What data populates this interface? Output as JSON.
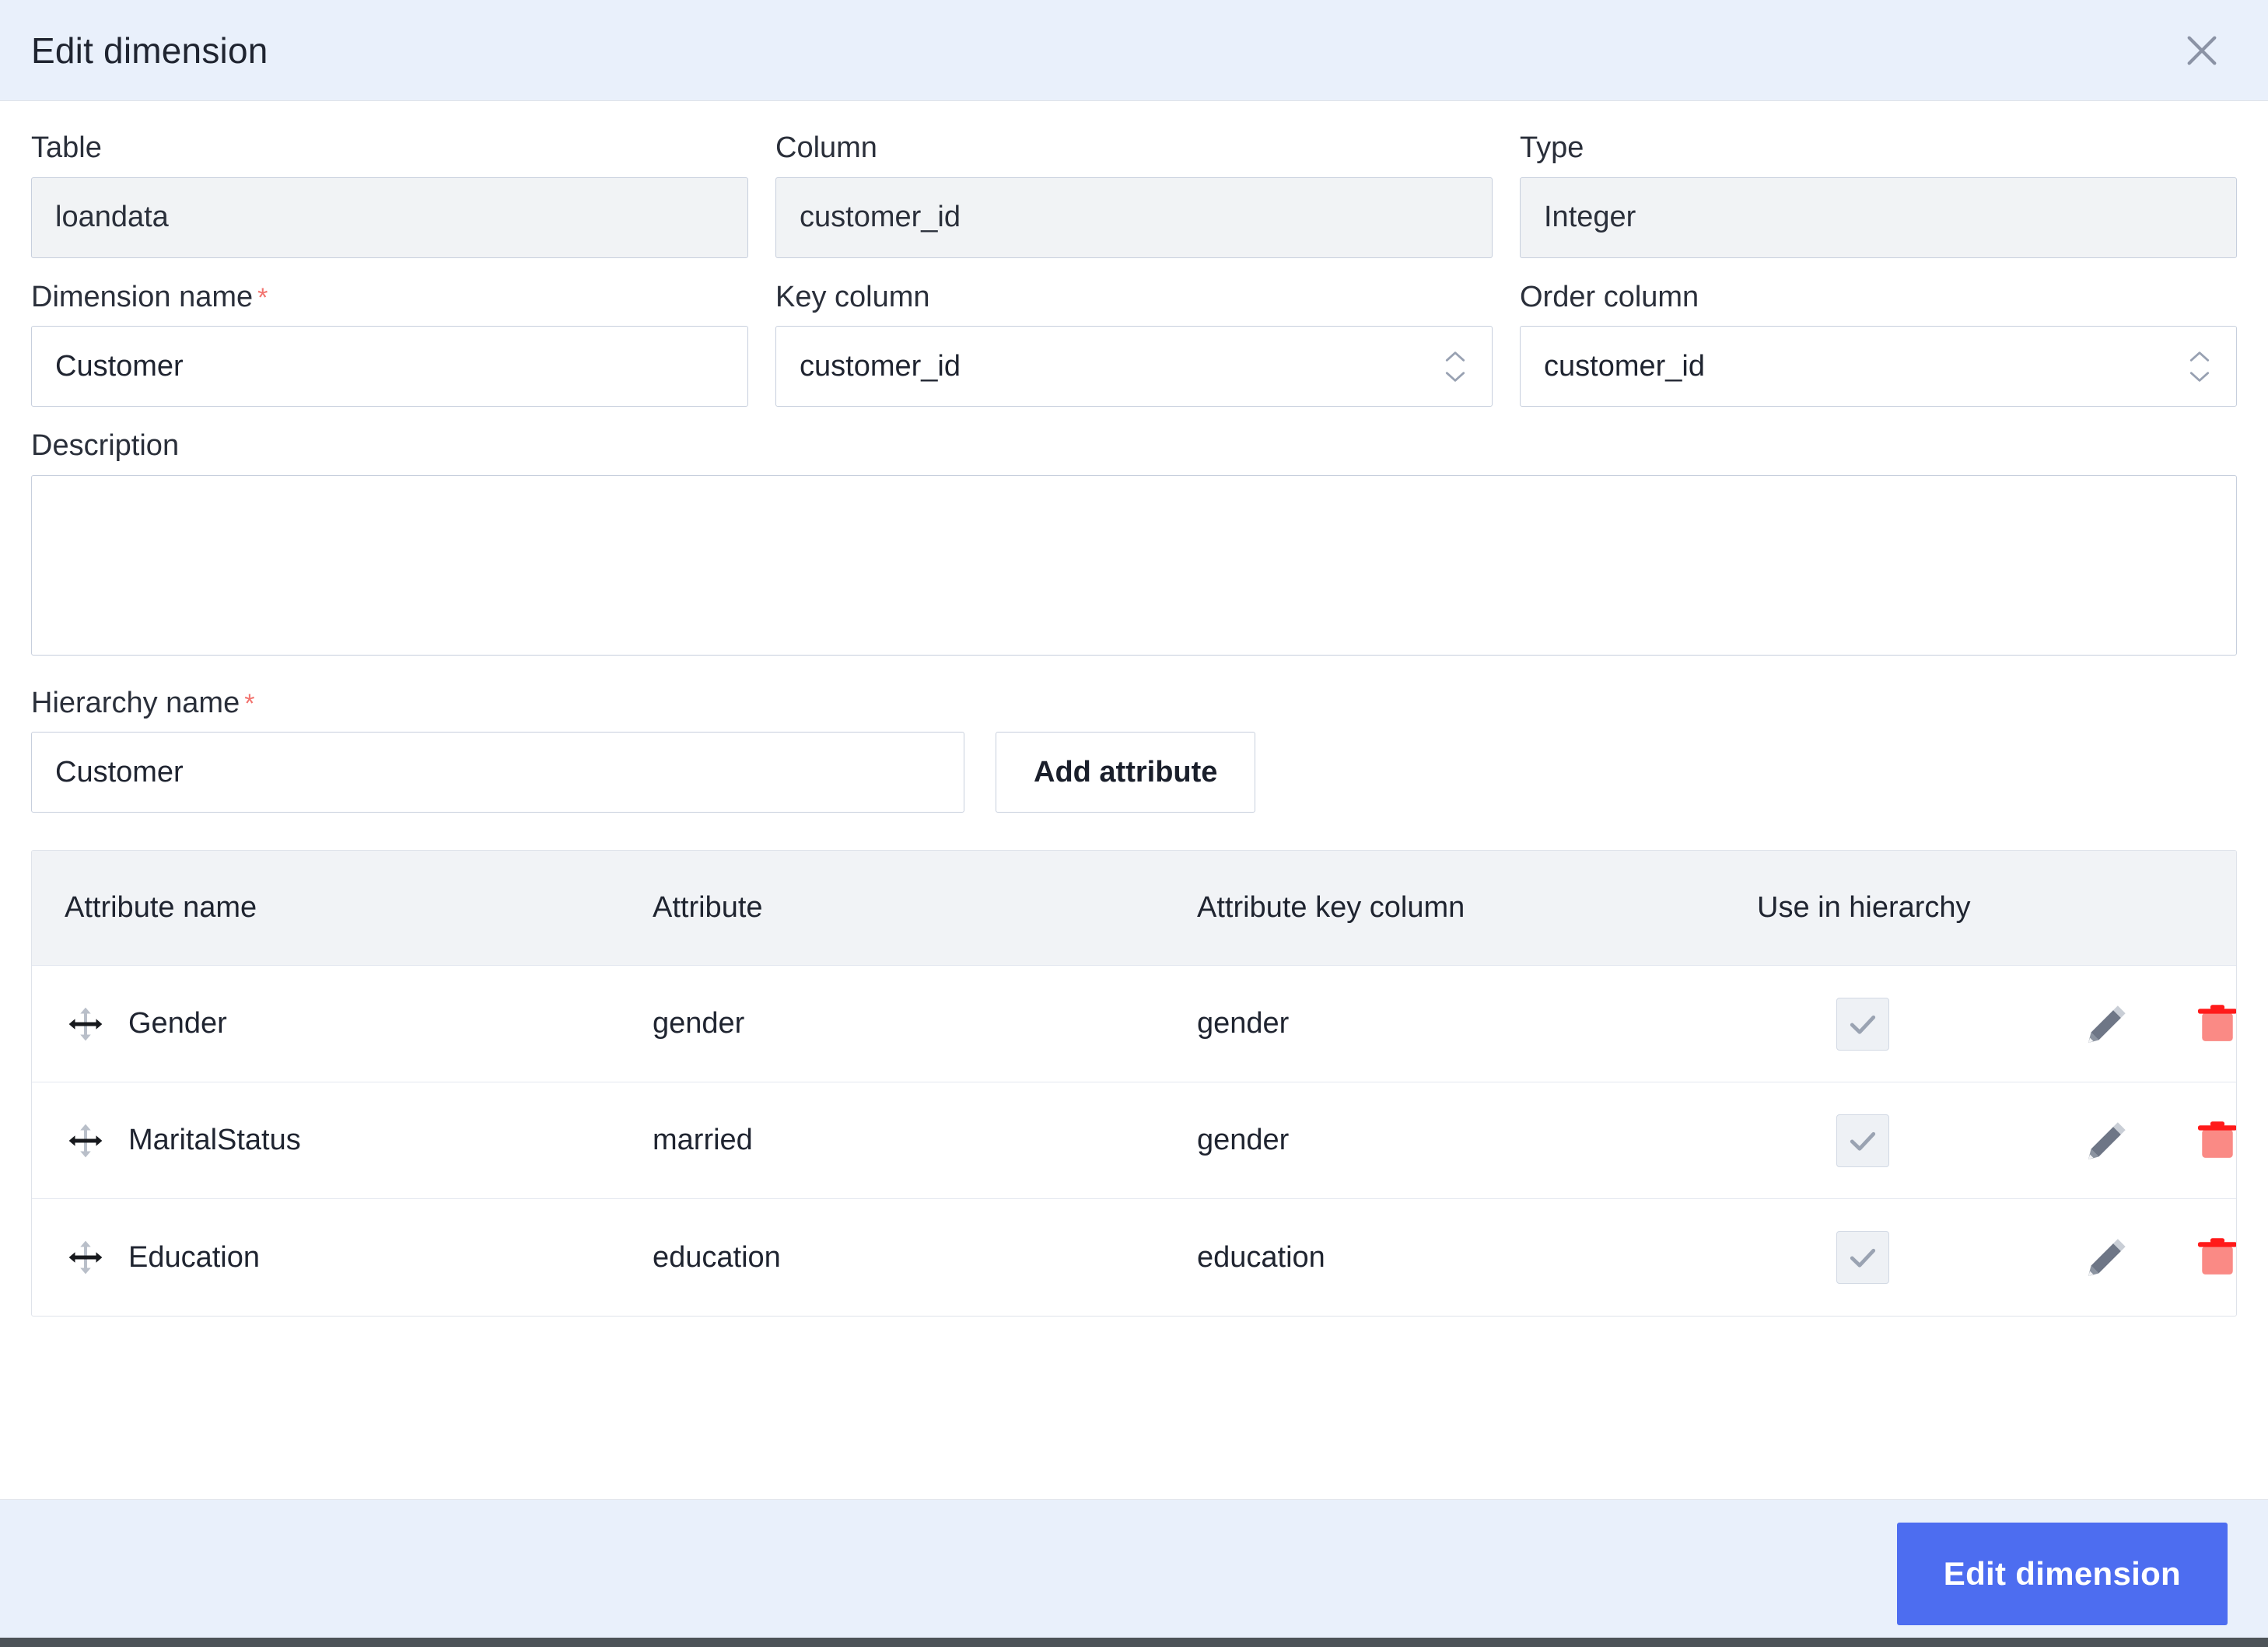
{
  "header": {
    "title": "Edit dimension",
    "close_icon": "close-icon"
  },
  "form": {
    "table": {
      "label": "Table",
      "value": "loandata",
      "disabled": true
    },
    "column": {
      "label": "Column",
      "value": "customer_id",
      "disabled": true
    },
    "type": {
      "label": "Type",
      "value": "Integer",
      "disabled": true
    },
    "dimension_name": {
      "label": "Dimension name",
      "required_mark": "*",
      "value": "Customer"
    },
    "key_column": {
      "label": "Key column",
      "value": "customer_id",
      "spinner_icon": "chevron-updown-icon"
    },
    "order_column": {
      "label": "Order column",
      "value": "customer_id",
      "spinner_icon": "chevron-updown-icon"
    },
    "description": {
      "label": "Description",
      "value": "",
      "placeholder": ""
    },
    "hierarchy_name": {
      "label": "Hierarchy name",
      "required_mark": "*",
      "value": "Customer"
    },
    "add_attribute_label": "Add attribute"
  },
  "attributes_table": {
    "headers": {
      "name": "Attribute name",
      "attribute": "Attribute",
      "key_column": "Attribute key column",
      "use_in_hierarchy": "Use in hierarchy"
    },
    "rows": [
      {
        "name": "Gender",
        "attribute": "gender",
        "key_column": "gender",
        "use_in_hierarchy": true
      },
      {
        "name": "MaritalStatus",
        "attribute": "married",
        "key_column": "gender",
        "use_in_hierarchy": true
      },
      {
        "name": "Education",
        "attribute": "education",
        "key_column": "education",
        "use_in_hierarchy": true
      }
    ],
    "row_icons": {
      "drag": "move-arrows-icon",
      "edit": "pencil-icon",
      "delete": "trash-icon",
      "checked": "check-icon"
    }
  },
  "footer": {
    "primary_label": "Edit dimension"
  },
  "colors": {
    "accent": "#4d6df0",
    "header_bg": "#e9f0fb",
    "required": "#f2736e",
    "trash": "#fa8a85",
    "trash_lid": "#ff1a1a",
    "pencil": "#6e7686"
  }
}
